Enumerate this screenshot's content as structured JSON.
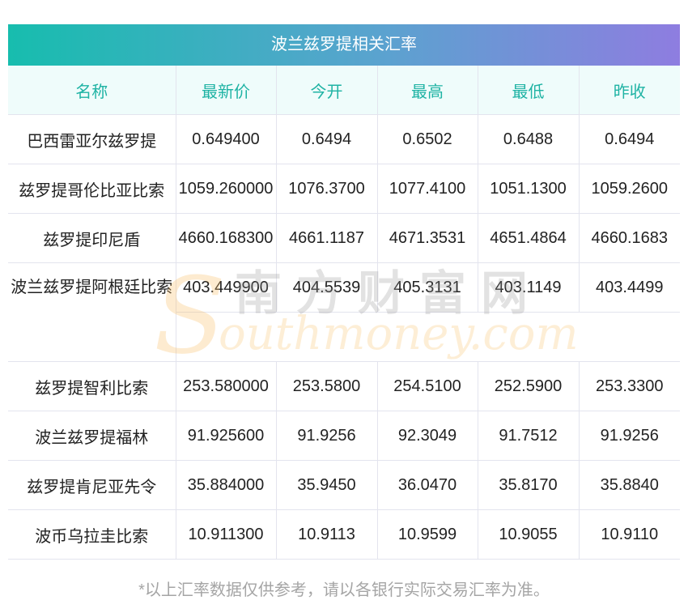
{
  "title": "波兰兹罗提相关汇率",
  "headers": [
    "名称",
    "最新价",
    "今开",
    "最高",
    "最低",
    "昨收"
  ],
  "rows": [
    [
      "巴西雷亚尔兹罗提",
      "0.649400",
      "0.6494",
      "0.6502",
      "0.6488",
      "0.6494"
    ],
    [
      "兹罗提哥伦比亚比索",
      "1059.260000",
      "1076.3700",
      "1077.4100",
      "1051.1300",
      "1059.2600"
    ],
    [
      "兹罗提印尼盾",
      "4660.168300",
      "4661.1187",
      "4671.3531",
      "4651.4864",
      "4660.1683"
    ],
    [
      "波兰兹罗提阿根廷比索",
      "403.449900",
      "404.5539",
      "405.3131",
      "403.1149",
      "403.4499"
    ],
    [
      "兹罗提智利比索",
      "253.580000",
      "253.5800",
      "254.5100",
      "252.5900",
      "253.3300"
    ],
    [
      "波兰兹罗提福林",
      "91.925600",
      "91.9256",
      "92.3049",
      "91.7512",
      "91.9256"
    ],
    [
      "兹罗提肯尼亚先令",
      "35.884000",
      "35.9450",
      "36.0470",
      "35.8170",
      "35.8840"
    ],
    [
      "波币乌拉圭比索",
      "10.911300",
      "10.9113",
      "10.9599",
      "10.9055",
      "10.9110"
    ]
  ],
  "watermark": {
    "cn": "南方财富网",
    "s": "S",
    "en": "outhmoney.com"
  },
  "note": "*以上汇率数据仅供参考，请以各银行实际交易汇率为准。"
}
